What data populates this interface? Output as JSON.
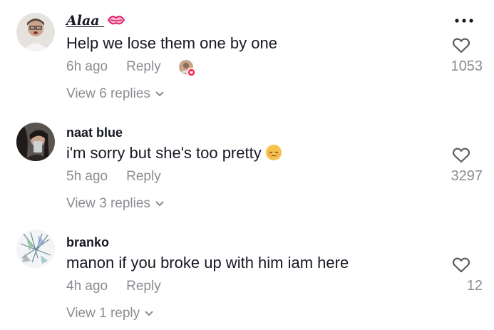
{
  "comments": [
    {
      "username": "Alaa",
      "username_decoration": "kiss-mark-icon",
      "text": "Help we lose them one by one",
      "time": "6h ago",
      "reply_label": "Reply",
      "creator_liked": true,
      "replies_label": "View 6 replies",
      "likes": "1053",
      "avatar_color": "#d9d4cf"
    },
    {
      "username": "naat blue",
      "text": "i'm sorry but she's too pretty",
      "text_emoji": "pensive-face-icon",
      "time": "5h ago",
      "reply_label": "Reply",
      "replies_label": "View 3 replies",
      "likes": "3297",
      "avatar_color": "#3a3a3a"
    },
    {
      "username": "branko",
      "text": "manon if you broke up with him iam here",
      "time": "4h ago",
      "reply_label": "Reply",
      "replies_label": "View 1 reply",
      "likes": "12",
      "avatar_color": "#e8eef0"
    }
  ],
  "colors": {
    "text": "#161823",
    "muted": "rgba(22,24,35,0.5)",
    "accent": "#fe2c55"
  }
}
